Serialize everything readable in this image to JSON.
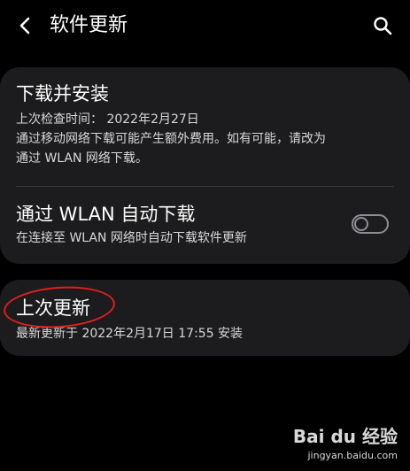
{
  "header": {
    "title": "软件更新",
    "back_icon": "chevron-left-icon",
    "search_icon": "search-icon"
  },
  "download_install": {
    "title": "下载并安装",
    "last_check": "上次检查时间： 2022年2月27日",
    "note_line1": "通过移动网络下载可能产生额外费用。如有可能，请改为",
    "note_line2": "通过 WLAN 网络下载。"
  },
  "auto_download": {
    "title": "通过 WLAN 自动下载",
    "subtitle": "在连接至 WLAN 网络时自动下载软件更新",
    "toggle_state": "off"
  },
  "last_update": {
    "title": "上次更新",
    "subtitle": "最新更新于 2022年2月17日 17:55 安装"
  },
  "annotation": {
    "color": "#e0201a"
  },
  "watermark": {
    "logo": "Bai du 经验",
    "url": "jingyan.baidu.com"
  },
  "colors": {
    "background": "#000000",
    "card": "#1c1c1e",
    "toggle_off": "#8e8e93"
  }
}
